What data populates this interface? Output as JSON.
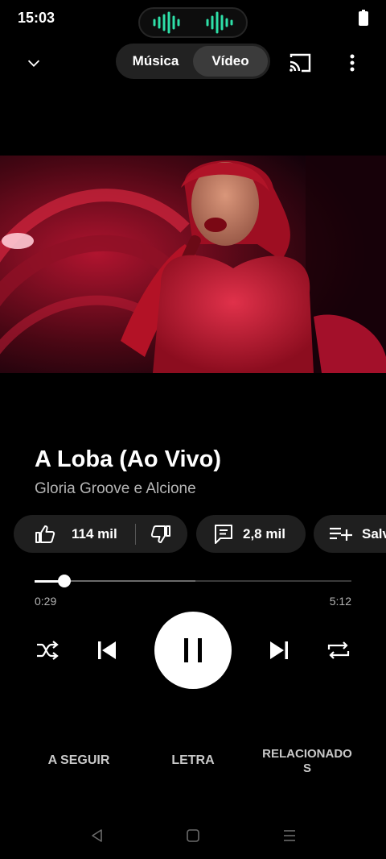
{
  "status_bar": {
    "time": "15:03"
  },
  "header": {
    "tabs": [
      {
        "label": "Música",
        "active": false
      },
      {
        "label": "Vídeo",
        "active": true
      }
    ],
    "icons": [
      "chevron-down-icon",
      "cast-icon",
      "more-vert-icon"
    ]
  },
  "track": {
    "title": "A Loba (Ao Vivo)",
    "artist": "Gloria Groove e Alcione"
  },
  "actions": {
    "likes": "114 mil",
    "comments": "2,8 mil",
    "save": "Salvar"
  },
  "progress": {
    "current": "0:29",
    "total": "5:12",
    "played_fraction": 0.093
  },
  "controls": [
    "shuffle-icon",
    "skip-previous-icon",
    "pause-icon",
    "skip-next-icon",
    "repeat-icon"
  ],
  "bottom_tabs": [
    {
      "label": "A SEGUIR"
    },
    {
      "label": "LETRA"
    },
    {
      "label": "RELACIONADOS"
    }
  ],
  "colors": {
    "background": "#000000",
    "chip": "#1f1f1f",
    "voice_wave": "#2ee0a8"
  }
}
